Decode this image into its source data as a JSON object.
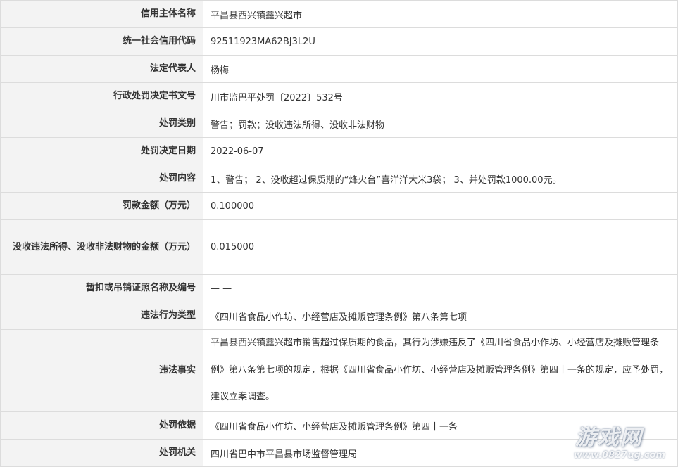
{
  "rows": [
    {
      "label": "信用主体名称",
      "value": "平昌县西兴镇鑫兴超市"
    },
    {
      "label": "统一社会信用代码",
      "value": "92511923MA62BJ3L2U"
    },
    {
      "label": "法定代表人",
      "value": "杨梅"
    },
    {
      "label": "行政处罚决定书文号",
      "value": "川市监巴平处罚〔2022〕532号"
    },
    {
      "label": "处罚类别",
      "value": "警告；罚款；没收违法所得、没收非法财物"
    },
    {
      "label": "处罚决定日期",
      "value": "2022-06-07"
    },
    {
      "label": "处罚内容",
      "value": "1、警告； 2、没收超过保质期的“烽火台”喜洋洋大米3袋； 3、并处罚款1000.00元。"
    },
    {
      "label": "罚款金额（万元）",
      "value": "0.100000"
    },
    {
      "label": "没收违法所得、没收非法财物的金额（万元）",
      "value": "0.015000"
    },
    {
      "label": "暂扣或吊销证照名称及编号",
      "value": "— —"
    },
    {
      "label": "违法行为类型",
      "value": "《四川省食品小作坊、小经营店及摊贩管理条例》第八条第七项"
    },
    {
      "label": "违法事实",
      "value": "平昌县西兴镇鑫兴超市销售超过保质期的食品，其行为涉嫌违反了《四川省食品小作坊、小经营店及摊贩管理条例》第八条第七项的规定，根据《四川省食品小作坊、小经营店及摊贩管理条例》第四十一条的规定，应予处罚，建议立案调查。"
    },
    {
      "label": "处罚依据",
      "value": "《四川省食品小作坊、小经营店及摊贩管理条例》第四十一条"
    },
    {
      "label": "处罚机关",
      "value": "四川省巴中市平昌县市场监督管理局"
    }
  ],
  "watermark": {
    "title": "游戏网",
    "url": "www.0827ug.com"
  }
}
